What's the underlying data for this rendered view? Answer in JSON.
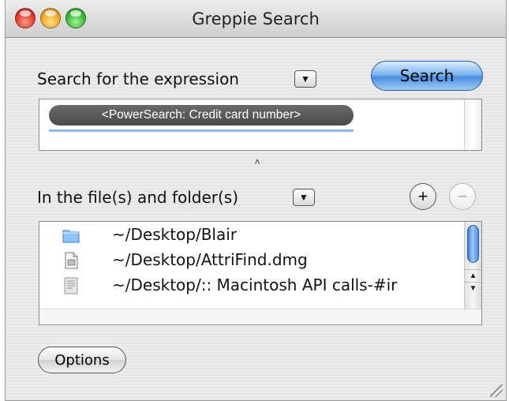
{
  "window": {
    "title": "Greppie Search"
  },
  "search": {
    "label": "Search for the expression",
    "button_label": "Search",
    "token": "<PowerSearch: Credit card number>"
  },
  "files": {
    "label": "In the file(s) and folder(s)",
    "add_label": "+",
    "remove_label": "−",
    "items": [
      {
        "path": "~/Desktop/Blair",
        "icon": "folder-icon"
      },
      {
        "path": "~/Desktop/AttriFind.dmg",
        "icon": "disk-image-icon"
      },
      {
        "path": "~/Desktop/:: Macintosh API calls-#ir",
        "icon": "document-icon"
      }
    ]
  },
  "options": {
    "button_label": "Options"
  },
  "icons": {
    "popup": "▼",
    "splitter": "˄",
    "scroll_up": "▲",
    "scroll_down": "▼"
  },
  "colors": {
    "accent_blue": "#4a8fe0",
    "token_bg": "#555555",
    "close": "#e23a2c",
    "minimize": "#f0a623",
    "zoom": "#3cb83a"
  }
}
